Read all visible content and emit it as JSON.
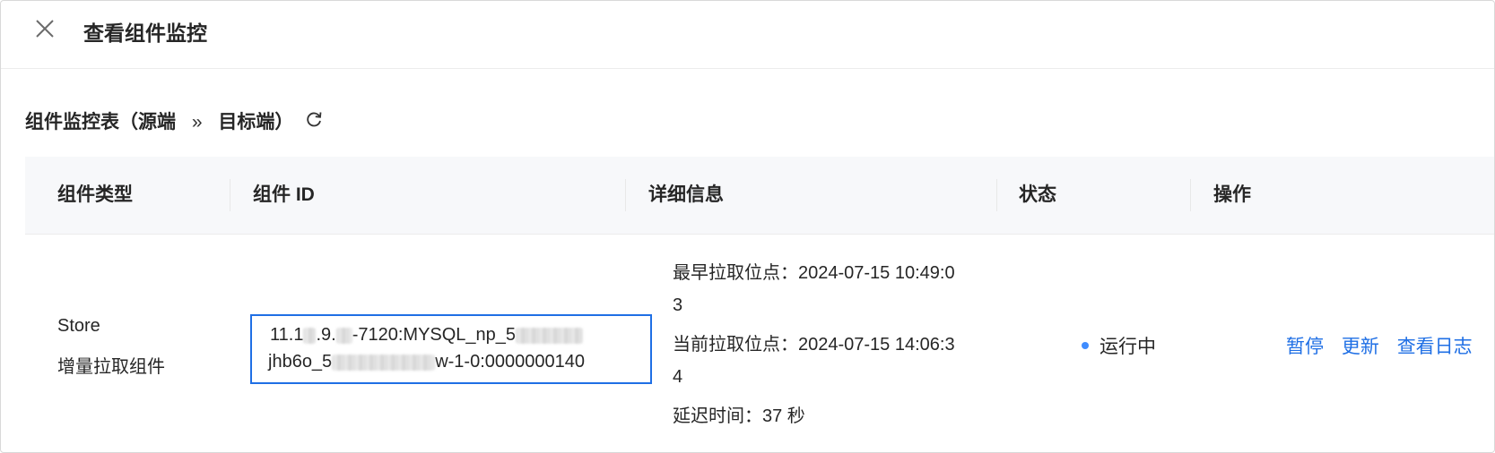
{
  "header": {
    "title": "查看组件监控"
  },
  "section": {
    "title_prefix": "组件监控表（源端",
    "arrow": "»",
    "title_suffix": "目标端）"
  },
  "table": {
    "columns": [
      "组件类型",
      "组件 ID",
      "详细信息",
      "状态",
      "操作"
    ],
    "rows": [
      {
        "type_line1": "Store",
        "type_line2": "增量拉取组件",
        "id_line1_a": "11.1",
        "id_line1_b": ".9.",
        "id_line1_c": "-7120:MYSQL_np_5",
        "id_line2_a": "jhb6o_5",
        "id_line2_b": "w-1-0:0000000140",
        "earliest_line1": "最早拉取位点：2024-07-15 10:49:0",
        "earliest_line2": "3",
        "current_line1": "当前拉取位点：2024-07-15 14:06:3",
        "current_line2": "4",
        "delay": "延迟时间：37 秒",
        "status": "运行中",
        "status_color": "#3f8cff",
        "actions": [
          "暂停",
          "更新",
          "查看日志"
        ]
      }
    ]
  },
  "colors": {
    "accent": "#1f6fe5",
    "header_bg": "#f7f8fa"
  },
  "icons": {
    "close": "close-icon",
    "refresh": "refresh-icon"
  }
}
